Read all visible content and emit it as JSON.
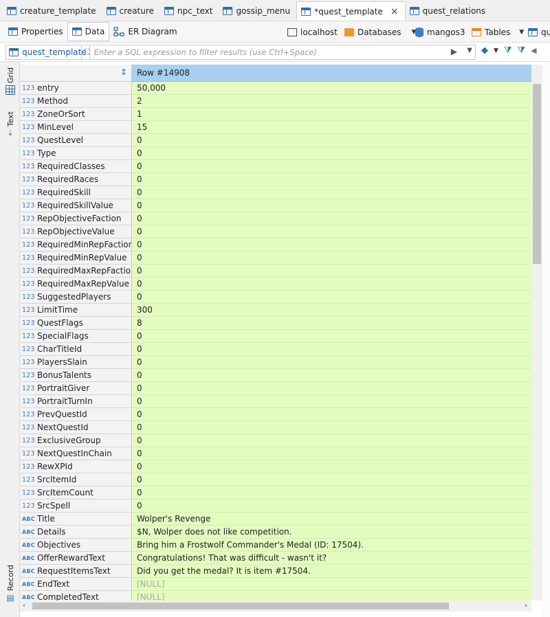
{
  "editor_tabs": [
    {
      "label": "creature_template"
    },
    {
      "label": "creature"
    },
    {
      "label": "npc_text"
    },
    {
      "label": "gossip_menu"
    },
    {
      "label": "*quest_template",
      "active": true
    },
    {
      "label": "quest_relations"
    }
  ],
  "subtabs": {
    "properties": "Properties",
    "data": "Data",
    "er_diagram": "ER Diagram"
  },
  "connection": {
    "host": "localhost",
    "databases": "Databases",
    "schema": "mangos3",
    "tables": "Tables",
    "overflow": "qu"
  },
  "filter": {
    "table": "quest_template",
    "placeholder": "Enter a SQL expression to filter results (use Ctrl+Space)"
  },
  "side_tabs": {
    "grid": "Grid",
    "text": "Text",
    "record": "Record"
  },
  "record_header": "Row  #14908",
  "fields": [
    {
      "type": "123",
      "name": "entry",
      "value": "50,000"
    },
    {
      "type": "123",
      "name": "Method",
      "value": "2"
    },
    {
      "type": "123",
      "name": "ZoneOrSort",
      "value": "1"
    },
    {
      "type": "123",
      "name": "MinLevel",
      "value": "15"
    },
    {
      "type": "123",
      "name": "QuestLevel",
      "value": "0"
    },
    {
      "type": "123",
      "name": "Type",
      "value": "0"
    },
    {
      "type": "123",
      "name": "RequiredClasses",
      "value": "0"
    },
    {
      "type": "123",
      "name": "RequiredRaces",
      "value": "0"
    },
    {
      "type": "123",
      "name": "RequiredSkill",
      "value": "0"
    },
    {
      "type": "123",
      "name": "RequiredSkillValue",
      "value": "0"
    },
    {
      "type": "123",
      "name": "RepObjectiveFaction",
      "value": "0"
    },
    {
      "type": "123",
      "name": "RepObjectiveValue",
      "value": "0"
    },
    {
      "type": "123",
      "name": "RequiredMinRepFaction",
      "value": "0"
    },
    {
      "type": "123",
      "name": "RequiredMinRepValue",
      "value": "0"
    },
    {
      "type": "123",
      "name": "RequiredMaxRepFaction",
      "value": "0"
    },
    {
      "type": "123",
      "name": "RequiredMaxRepValue",
      "value": "0"
    },
    {
      "type": "123",
      "name": "SuggestedPlayers",
      "value": "0"
    },
    {
      "type": "123",
      "name": "LimitTime",
      "value": "300"
    },
    {
      "type": "123",
      "name": "QuestFlags",
      "value": "8"
    },
    {
      "type": "123",
      "name": "SpecialFlags",
      "value": "0"
    },
    {
      "type": "123",
      "name": "CharTitleId",
      "value": "0"
    },
    {
      "type": "123",
      "name": "PlayersSlain",
      "value": "0"
    },
    {
      "type": "123",
      "name": "BonusTalents",
      "value": "0"
    },
    {
      "type": "123",
      "name": "PortraitGiver",
      "value": "0"
    },
    {
      "type": "123",
      "name": "PortraitTurnIn",
      "value": "0"
    },
    {
      "type": "123",
      "name": "PrevQuestId",
      "value": "0"
    },
    {
      "type": "123",
      "name": "NextQuestId",
      "value": "0"
    },
    {
      "type": "123",
      "name": "ExclusiveGroup",
      "value": "0"
    },
    {
      "type": "123",
      "name": "NextQuestInChain",
      "value": "0"
    },
    {
      "type": "123",
      "name": "RewXPId",
      "value": "0"
    },
    {
      "type": "123",
      "name": "SrcItemId",
      "value": "0"
    },
    {
      "type": "123",
      "name": "SrcItemCount",
      "value": "0"
    },
    {
      "type": "123",
      "name": "SrcSpell",
      "value": "0"
    },
    {
      "type": "ABC",
      "name": "Title",
      "value": "Wolper's Revenge"
    },
    {
      "type": "ABC",
      "name": "Details",
      "value": "$N, Wolper does not like competition."
    },
    {
      "type": "ABC",
      "name": "Objectives",
      "value": "Bring him a Frostwolf Commander's Medal (ID: 17504)."
    },
    {
      "type": "ABC",
      "name": "OfferRewardText",
      "value": "Congratulations! That was difficult - wasn't it?"
    },
    {
      "type": "ABC",
      "name": "RequestItemsText",
      "value": "Did you get the medal? It is item #17504."
    },
    {
      "type": "ABC",
      "name": "EndText",
      "value": "[NULL]",
      "null": true
    },
    {
      "type": "ABC",
      "name": "CompletedText",
      "value": "[NULL]",
      "null": true
    }
  ]
}
